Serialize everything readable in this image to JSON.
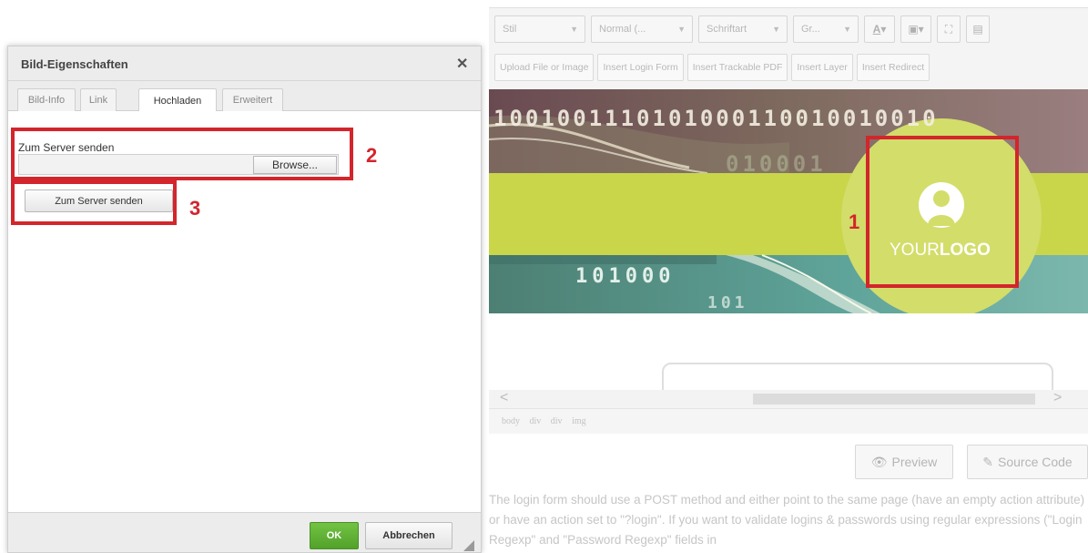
{
  "editor": {
    "toolbar_row1": {
      "style_combo": "Stil",
      "format_combo": "Normal (...",
      "font_combo": "Schriftart",
      "size_combo": "Gr...",
      "text_color_icon": "text-color-icon",
      "bg_color_icon": "background-color-icon",
      "maximize_icon": "maximize-icon",
      "show_blocks_icon": "show-blocks-icon"
    },
    "toolbar_row2": [
      "Upload File or Image",
      "Insert Login Form",
      "Insert Trackable PDF",
      "Insert Layer",
      "Insert Redirect"
    ],
    "banner": {
      "binary_top": "1001001110101000110010010010",
      "binary_mid": "010001",
      "binary_low": "101000",
      "binary_low2": "101",
      "logo_your": "YOUR",
      "logo_logo": "LOGO",
      "logo_icon": "user-avatar-icon",
      "colors": {
        "band": "#c9d64a",
        "circle": "#d3dd6a",
        "teal": "#5ea39c"
      }
    },
    "scroll_left": "<",
    "scroll_right": ">",
    "path": [
      "body",
      "div",
      "div",
      "img"
    ],
    "preview_button": "Preview",
    "source_button": "Source Code",
    "help_text": "The login form should use a POST method and either point to the same page (have an empty action attribute) or have an action set to \"?login\". If you want to validate logins & passwords using regular expressions (\"Login Regexp\" and \"Password Regexp\" fields in"
  },
  "dialog": {
    "title": "Bild-Eigenschaften",
    "close": "✕",
    "tabs": [
      "Bild-Info",
      "Link",
      "Hochladen",
      "Erweitert"
    ],
    "active_tab": "Hochladen",
    "upload_label": "Zum Server senden",
    "browse_button": "Browse...",
    "send_button": "Zum Server senden",
    "ok_button": "OK",
    "cancel_button": "Abbrechen"
  },
  "annotations": {
    "one": "1",
    "two": "2",
    "three": "3",
    "color": "#d3252c"
  }
}
